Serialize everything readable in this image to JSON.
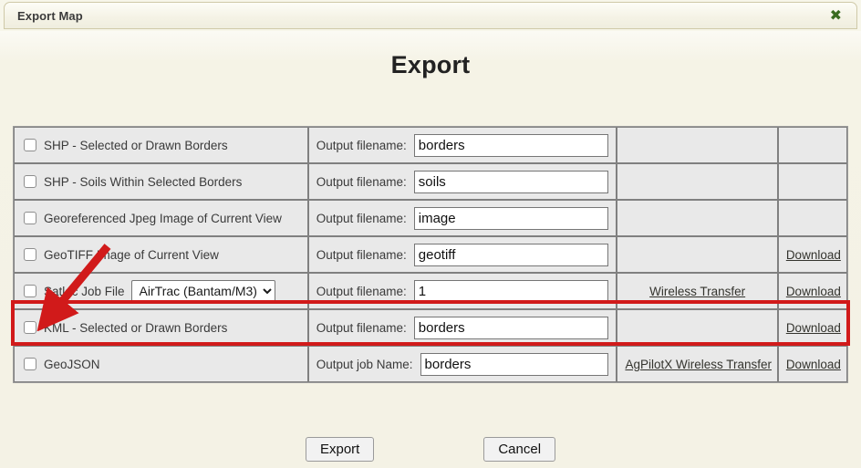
{
  "window": {
    "title": "Export Map",
    "close_icon": "close-x-icon",
    "close_glyph": "✖"
  },
  "page": {
    "heading": "Export"
  },
  "table": {
    "rows": [
      {
        "type_label": "SHP - Selected or Drawn Borders",
        "checked": false,
        "has_select": false,
        "name_label": "Output filename:",
        "filename": "borders",
        "wireless_link": "",
        "download_link": ""
      },
      {
        "type_label": "SHP - Soils Within Selected Borders",
        "checked": false,
        "has_select": false,
        "name_label": "Output filename:",
        "filename": "soils",
        "wireless_link": "",
        "download_link": ""
      },
      {
        "type_label": "Georeferenced Jpeg Image of Current View",
        "checked": false,
        "has_select": false,
        "name_label": "Output filename:",
        "filename": "image",
        "wireless_link": "",
        "download_link": ""
      },
      {
        "type_label": "GeoTIFF Image of Current View",
        "checked": false,
        "has_select": false,
        "name_label": "Output filename:",
        "filename": "geotiff",
        "wireless_link": "",
        "download_link": "Download"
      },
      {
        "type_label": "Satloc Job File",
        "checked": false,
        "has_select": true,
        "select_value": "AirTrac (Bantam/M3)",
        "name_label": "Output filename:",
        "filename": "1",
        "wireless_link": "Wireless Transfer",
        "download_link": "Download"
      },
      {
        "type_label": "KML - Selected or Drawn Borders",
        "checked": false,
        "has_select": false,
        "name_label": "Output filename:",
        "filename": "borders",
        "wireless_link": "",
        "download_link": "Download"
      },
      {
        "type_label": "GeoJSON",
        "checked": false,
        "has_select": false,
        "name_label": "Output job Name:",
        "filename": "borders",
        "wireless_link": "AgPilotX Wireless Transfer",
        "download_link": "Download"
      }
    ]
  },
  "footer": {
    "export_label": "Export",
    "cancel_label": "Cancel"
  },
  "annotations": {
    "highlight_color": "#d11a1a",
    "arrow_color": "#d11a1a"
  }
}
